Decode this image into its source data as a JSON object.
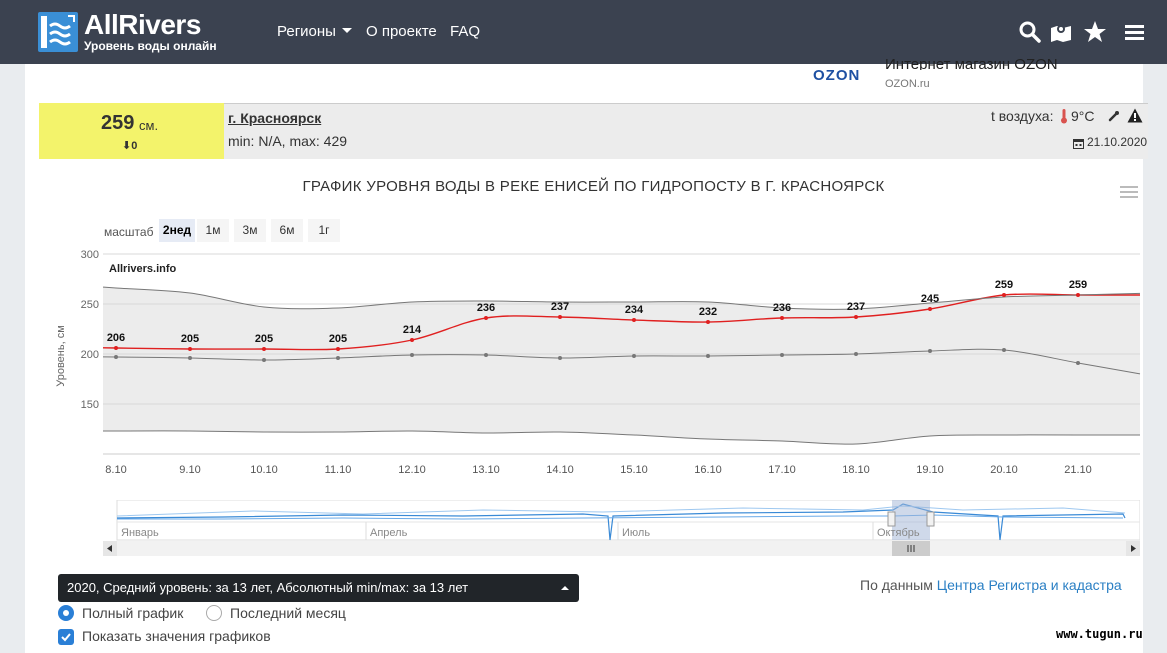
{
  "header": {
    "brand": "AllRivers",
    "subtitle": "Уровень воды онлайн",
    "nav": [
      {
        "label": "Регионы"
      },
      {
        "label": "О проекте"
      },
      {
        "label": "FAQ"
      }
    ]
  },
  "ad": {
    "logo": "OZON",
    "title": "Интернет магазин OZON",
    "url": "OZON.ru"
  },
  "station": {
    "level": "259",
    "unit": "см.",
    "delta": "⬇0",
    "city": "г. Красноярск",
    "minmax": "min: N/A, max: 429",
    "air_label": "t воздуха:",
    "air_value": "9°C",
    "date": "21.10.2020"
  },
  "chart_data": {
    "type": "line",
    "title": "ГРАФИК УРОВНЯ ВОДЫ В РЕКЕ ЕНИСЕЙ ПО ГИДРОПОСТУ В Г. КРАСНОЯРСК",
    "credit": "Allrivers.info",
    "ylabel": "Уровень, см",
    "xlabel": "",
    "ylim": [
      100,
      300
    ],
    "yticks": [
      150,
      200,
      250,
      300
    ],
    "categories": [
      "8.10",
      "9.10",
      "10.10",
      "11.10",
      "12.10",
      "13.10",
      "14.10",
      "15.10",
      "16.10",
      "17.10",
      "18.10",
      "19.10",
      "20.10",
      "21.10"
    ],
    "series": [
      {
        "values": [
          206,
          205,
          205,
          205,
          214,
          236,
          237,
          234,
          232,
          236,
          237,
          245,
          259,
          259
        ],
        "color": "#e02020",
        "labels": true
      },
      {
        "values": [
          197,
          196,
          194,
          196,
          199,
          199,
          196,
          198,
          198,
          199,
          200,
          203,
          204,
          191
        ],
        "color": "#777777"
      },
      {
        "values": [
          266,
          261,
          247,
          246,
          252,
          253,
          252,
          252,
          252,
          246,
          245,
          251,
          257,
          259
        ],
        "color": "#777777"
      },
      {
        "values": [
          123,
          123,
          122,
          122,
          123,
          121,
          122,
          119,
          115,
          113,
          110,
          118,
          119,
          119
        ],
        "color": "#777777"
      }
    ],
    "range_label": "масштаб",
    "range_buttons": [
      {
        "label": "2нед",
        "active": true
      },
      {
        "label": "1м"
      },
      {
        "label": "3м"
      },
      {
        "label": "6м"
      },
      {
        "label": "1г"
      }
    ],
    "navigator_months": [
      "Январь",
      "Апрель",
      "Июль",
      "Октябрь"
    ],
    "grid": true,
    "legend": "none"
  },
  "controls": {
    "series_select": "2020, Средний уровень: за 13 лет, Абсолютный min/max: за 13 лет",
    "source_prefix": "По данным ",
    "source_link": "Центра Регистра и кадастра",
    "radio_full": "Полный график",
    "radio_month": "Последний месяц",
    "checkbox_values": "Показать значения графиков"
  },
  "watermark": "www.tugun.ru"
}
